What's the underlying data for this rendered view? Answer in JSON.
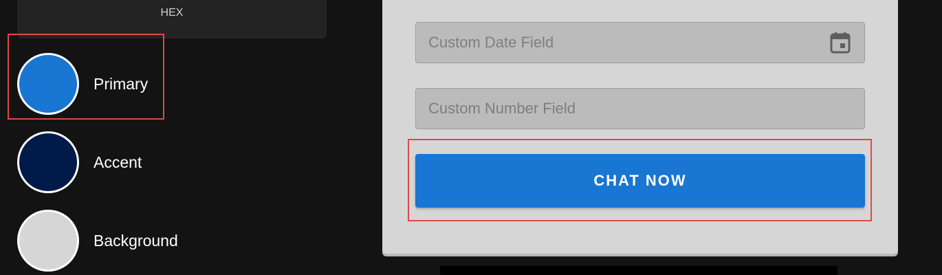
{
  "theme_panel": {
    "hex_label": "HEX",
    "swatches": [
      {
        "label": "Primary",
        "color": "#1976d2"
      },
      {
        "label": "Accent",
        "color": "#001a4a"
      },
      {
        "label": "Background",
        "color": "#d6d6d6"
      }
    ]
  },
  "form": {
    "date_field": {
      "placeholder": "Custom Date Field",
      "value": ""
    },
    "number_field": {
      "placeholder": "Custom Number Field",
      "value": ""
    },
    "chat_button_label": "CHAT NOW"
  },
  "icons": {
    "date_field_icon": "calendar-icon"
  },
  "colors": {
    "page_background": "#131313",
    "card_background": "#d6d6d6",
    "highlight": "#e04848",
    "primary": "#1976d2"
  }
}
